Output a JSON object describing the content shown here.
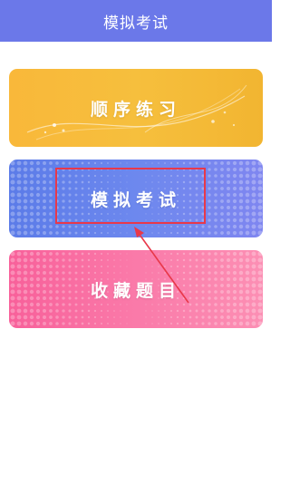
{
  "header": {
    "title": "模拟考试"
  },
  "cards": [
    {
      "label": "顺序练习",
      "color": "#f7bb3a"
    },
    {
      "label": "模拟考试",
      "color": "#6a86ed"
    },
    {
      "label": "收藏题目",
      "color": "#fa76a7"
    }
  ],
  "annotation": {
    "highlight_color": "#e8384a",
    "highlighted_card": "模拟考试"
  }
}
